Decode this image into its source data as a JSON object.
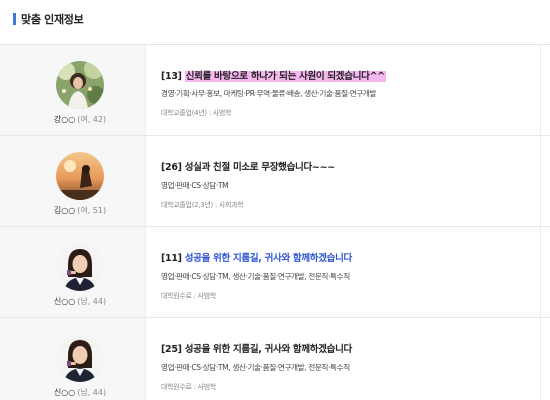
{
  "section": {
    "title": "맞춤 인재정보"
  },
  "colors": {
    "accent": "#3a7bd5",
    "link_blue": "#2e55d0",
    "highlight": "#f6b6f0"
  },
  "candidates": [
    {
      "name": "강○○",
      "meta": "(여, 42)",
      "avatar": "woman-flowers-photo",
      "number": "[13]",
      "headline": "신뢰를 바탕으로 하나가 되는 사원이 되겠습니다^^",
      "jobs": "경영·기획·사무·홍보, 마케팅·PR·무역·물류·배송, 생산·기술·품질·연구개발",
      "education": "대학교졸업(4년) : 사범학"
    },
    {
      "name": "김○○",
      "meta": "(여, 51)",
      "avatar": "silhouette-sunset-photo",
      "number": "[26]",
      "headline": "성실과 친절 미소로 무장했습니다~~~",
      "jobs": "영업·판매·CS·상담·TM",
      "education": "대학교졸업(2,3년) : 사회과학"
    },
    {
      "name": "신○○",
      "meta": "(남, 44)",
      "avatar": "business-woman-photo",
      "number": "[11]",
      "headline": "성공을 위한 지름길, 귀사와 함께하겠습니다",
      "jobs": "영업·판매·CS·상담·TM, 생산·기술·품질·연구개발, 전문직·특수직",
      "education": "대학원수료 : 사범학"
    },
    {
      "name": "신○○",
      "meta": "(남, 44)",
      "avatar": "business-woman-photo",
      "number": "[25]",
      "headline": "성공을 위한 지름길, 귀사와 함께하겠습니다",
      "jobs": "영업·판매·CS·상담·TM, 생산·기술·품질·연구개발, 전문직·특수직",
      "education": "대학원수료 : 사범학"
    }
  ]
}
